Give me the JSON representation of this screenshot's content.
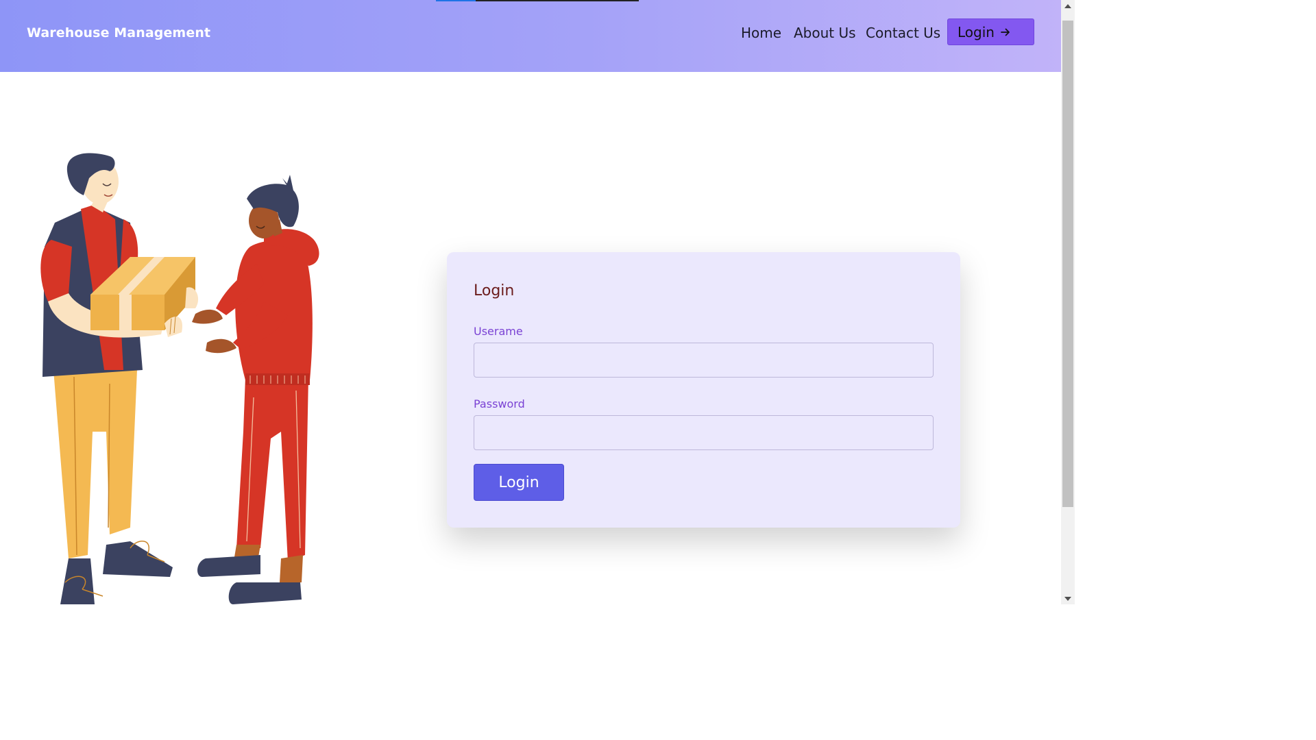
{
  "navbar": {
    "brand": "Warehouse Management",
    "links": [
      {
        "label": "Home"
      },
      {
        "label": "About Us"
      },
      {
        "label": "Contact Us"
      }
    ],
    "login_label": "Login",
    "login_icon": "arrow-right-icon"
  },
  "login_card": {
    "title": "Login",
    "username_label": "Userame",
    "username_value": "",
    "password_label": "Password",
    "password_value": "",
    "submit_label": "Login"
  },
  "illustration": "person-handing-box-illustration",
  "colors": {
    "nav_gradient_start": "#8e95f7",
    "nav_gradient_end": "#c1b3f9",
    "nav_button": "#8358f0",
    "card_bg": "#ebe8fd",
    "submit_button": "#5e5ee7",
    "label_color": "#7a42d4",
    "title_color": "#6b1c1c"
  }
}
